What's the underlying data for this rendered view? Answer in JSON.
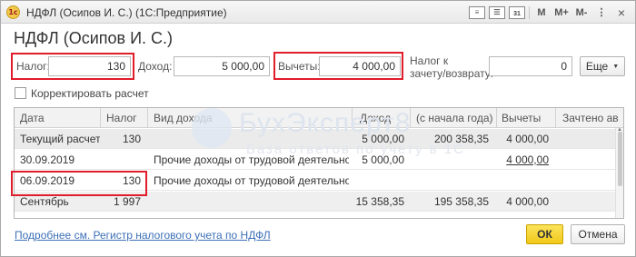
{
  "window": {
    "title": "НДФЛ (Осипов И. С.)  (1С:Предприятие)",
    "app_icon": "1с",
    "toolbar": {
      "doc_icon": "doc-icon",
      "list_icon": "list-icon",
      "calendar_day": "31",
      "m_label": "M",
      "m_plus_label": "M+",
      "m_minus_label": "M-",
      "more_label": "⋮",
      "close_label": "×"
    }
  },
  "form": {
    "title": "НДФЛ (Осипов И. С.)",
    "tax": {
      "label": "Налог:",
      "value": "130"
    },
    "income": {
      "label": "Доход:",
      "value": "5 000,00"
    },
    "deductions": {
      "label": "Вычеты:",
      "value": "4 000,00"
    },
    "refund": {
      "label_line1": "Налог к",
      "label_line2": "зачету/возврату:",
      "value": "0"
    },
    "more_button": "Еще",
    "adjust_checkbox": {
      "label": "Корректировать расчет",
      "checked": false
    }
  },
  "table": {
    "columns": [
      "Дата",
      "Налог",
      "Вид дохода",
      "Доход",
      "(с начала года)",
      "Вычеты",
      "Зачтено ав"
    ],
    "rows": [
      {
        "date": "Текущий расчет",
        "tax": "130",
        "income_type": "",
        "income": "5 000,00",
        "ytd": "200 358,35",
        "deductions": "4 000,00",
        "credited": ""
      },
      {
        "date": "30.09.2019",
        "tax": "",
        "income_type": "Прочие доходы от трудовой деятельности",
        "income": "5 000,00",
        "ytd": "",
        "deductions": "4 000,00",
        "credited": ""
      },
      {
        "date": "06.09.2019",
        "tax": "130",
        "income_type": "Прочие доходы от трудовой деятельности",
        "income": "",
        "ytd": "",
        "deductions": "",
        "credited": ""
      },
      {
        "date": "Сентябрь",
        "tax": "1 997",
        "income_type": "",
        "income": "15 358,35",
        "ytd": "195 358,35",
        "deductions": "4 000,00",
        "credited": ""
      }
    ]
  },
  "watermark": {
    "title": "БухЭксперт8",
    "subtitle": "База ответов по учету в 1С"
  },
  "footer": {
    "link": "Подробнее см. Регистр налогового учета по НДФЛ",
    "ok_button": "ОК",
    "cancel_button": "Отмена"
  },
  "colors": {
    "highlight": "#e01d2b",
    "ok_button": "#f2c91a",
    "link": "#3b6fb6"
  }
}
